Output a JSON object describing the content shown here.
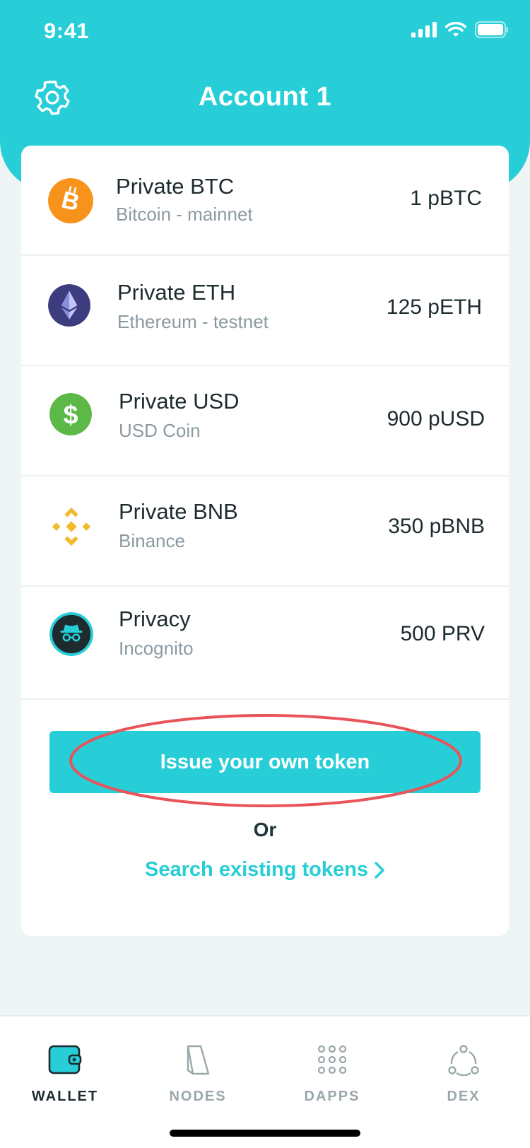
{
  "status_bar": {
    "time": "9:41"
  },
  "header": {
    "title": "Account 1"
  },
  "tokens": [
    {
      "name": "Private BTC",
      "network": "Bitcoin - mainnet",
      "amount": "1 pBTC",
      "icon": "bitcoin-icon",
      "color": "#f7931a"
    },
    {
      "name": "Private ETH",
      "network": "Ethereum - testnet",
      "amount": "125 pETH",
      "icon": "ethereum-icon",
      "color": "#3c3c7e"
    },
    {
      "name": "Private USD",
      "network": "USD Coin",
      "amount": "900 pUSD",
      "icon": "dollar-icon",
      "color": "#5cb947"
    },
    {
      "name": "Private BNB",
      "network": "Binance",
      "amount": "350 pBNB",
      "icon": "binance-icon",
      "color": "#f3ba2f"
    },
    {
      "name": "Privacy",
      "network": "Incognito",
      "amount": "500 PRV",
      "icon": "incognito-icon",
      "color": "#1d2b2f"
    }
  ],
  "actions": {
    "issue_label": "Issue your own token",
    "or_label": "Or",
    "search_label": "Search existing tokens"
  },
  "tabbar": {
    "items": [
      {
        "label": "WALLET",
        "icon": "wallet-icon",
        "active": true
      },
      {
        "label": "NODES",
        "icon": "node-icon",
        "active": false
      },
      {
        "label": "DAPPS",
        "icon": "grid-icon",
        "active": false
      },
      {
        "label": "DEX",
        "icon": "dex-icon",
        "active": false
      }
    ]
  },
  "colors": {
    "accent": "#27cdd7",
    "highlight": "#e8545a"
  }
}
